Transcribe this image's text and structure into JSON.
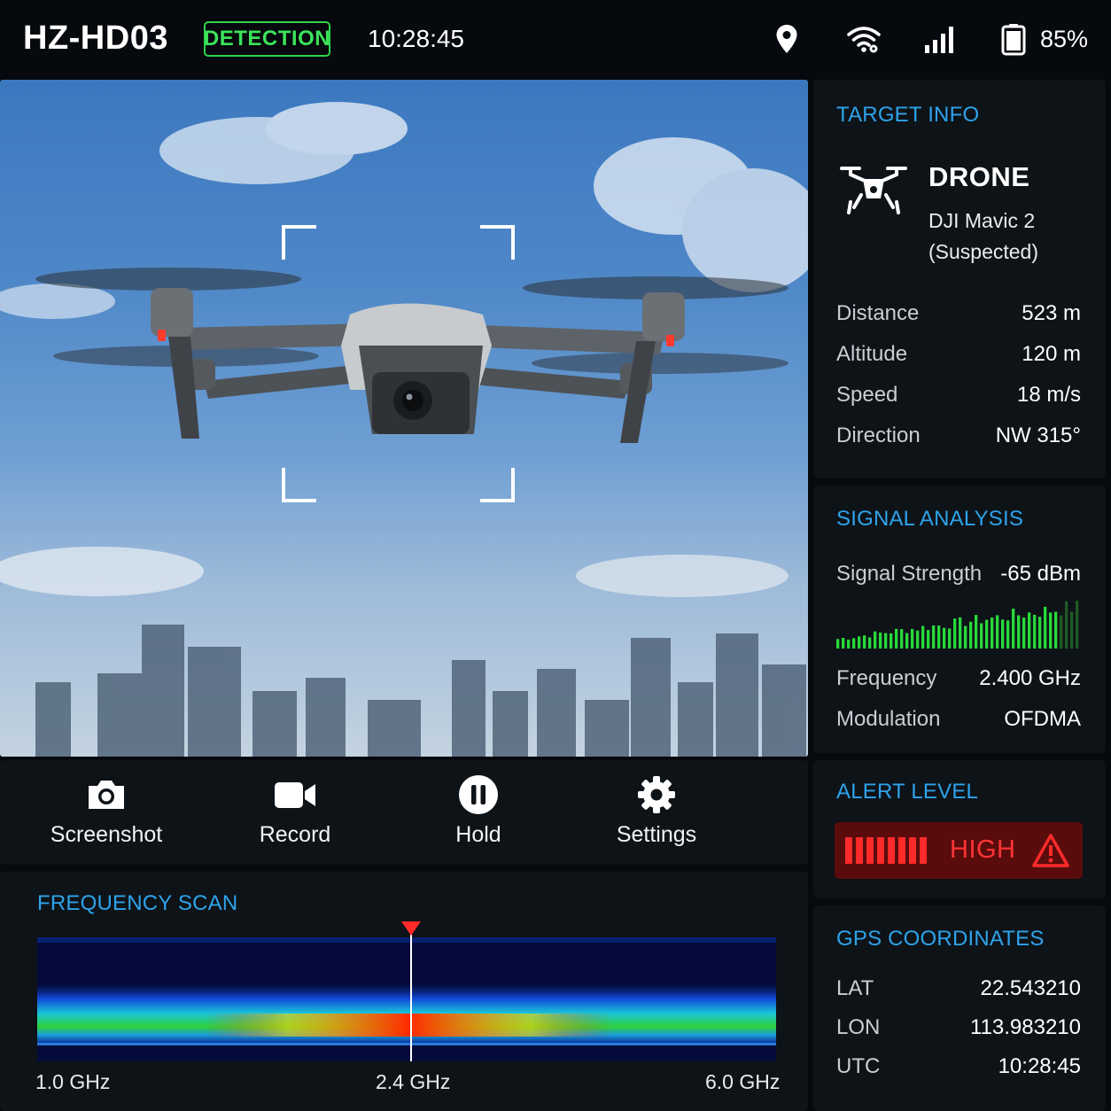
{
  "header": {
    "device_id": "HZ-HD03",
    "mode": "DETECTION",
    "time": "10:28:45",
    "battery": "85%",
    "icons": [
      "location-pin-icon",
      "wifi-icon",
      "cellular-signal-icon",
      "battery-icon"
    ],
    "accent_green": "#2fd44a"
  },
  "camera": {
    "reticle": "target-bracket-icon"
  },
  "controls": [
    {
      "label": "Screenshot",
      "icon": "camera-icon"
    },
    {
      "label": "Record",
      "icon": "video-camera-icon"
    },
    {
      "label": "Hold",
      "icon": "pause-icon"
    },
    {
      "label": "Settings",
      "icon": "gear-icon"
    }
  ],
  "frequency_scan": {
    "title": "FREQUENCY SCAN",
    "axis_labels": [
      "1.0 GHz",
      "2.4 GHz",
      "6.0 GHz"
    ],
    "marker": "2.4 GHz",
    "marker_color": "#ff2a2a"
  },
  "target_info": {
    "title": "TARGET INFO",
    "type": "DRONE",
    "model_line1": "DJI Mavic 2",
    "model_line2": "(Suspected)",
    "icon": "drone-icon",
    "rows": [
      {
        "key": "Distance",
        "value": "523 m"
      },
      {
        "key": "Altitude",
        "value": "120 m"
      },
      {
        "key": "Speed",
        "value": "18 m/s"
      },
      {
        "key": "Direction",
        "value": "NW 315°"
      }
    ]
  },
  "signal_analysis": {
    "title": "SIGNAL ANALYSIS",
    "strength_label": "Signal Strength",
    "strength_value": "-65 dBm",
    "bar_color": "#27d93a",
    "rows": [
      {
        "key": "Frequency",
        "value": "2.400 GHz"
      },
      {
        "key": "Modulation",
        "value": "OFDMA"
      }
    ]
  },
  "alert": {
    "title": "ALERT LEVEL",
    "level": "HIGH",
    "icon": "warning-icon",
    "color": "#ff2a2a"
  },
  "gps": {
    "title": "GPS COORDINATES",
    "rows": [
      {
        "key": "LAT",
        "value": "22.543210"
      },
      {
        "key": "LON",
        "value": "113.983210"
      },
      {
        "key": "UTC",
        "value": "10:28:45"
      }
    ]
  },
  "title_color": "#2ea3ea"
}
